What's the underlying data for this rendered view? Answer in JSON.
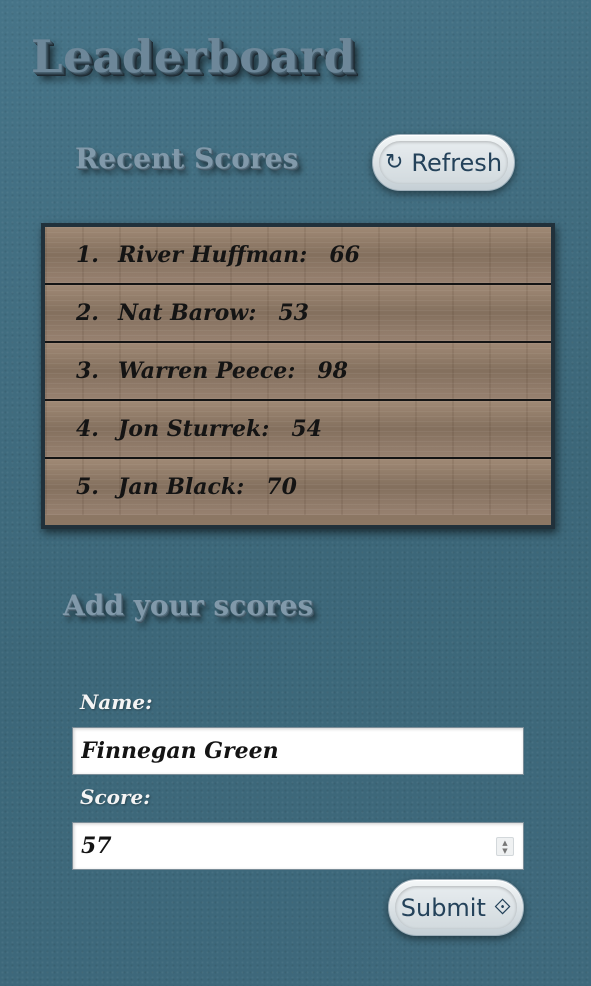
{
  "header": {
    "title": "Leaderboard"
  },
  "recent": {
    "heading": "Recent Scores",
    "refresh_label": "Refresh",
    "refresh_icon": "refresh-icon"
  },
  "leaderboard": [
    {
      "rank": "1.",
      "name": "River Huffman:",
      "score": "66"
    },
    {
      "rank": "2.",
      "name": "Nat Barow:",
      "score": "53"
    },
    {
      "rank": "3.",
      "name": "Warren Peece:",
      "score": "98"
    },
    {
      "rank": "4.",
      "name": "Jon Sturrek:",
      "score": "54"
    },
    {
      "rank": "5.",
      "name": "Jan Black:",
      "score": "70"
    }
  ],
  "form": {
    "heading": "Add your scores",
    "name_label": "Name:",
    "name_value": "Finnegan Green",
    "score_label": "Score:",
    "score_value": "57",
    "submit_label": "Submit",
    "submit_icon": "submit-icon"
  },
  "colors": {
    "background": "#3f6b80",
    "button_text": "#24425a",
    "label_text": "#f4f4f4",
    "board_text": "#141414"
  }
}
